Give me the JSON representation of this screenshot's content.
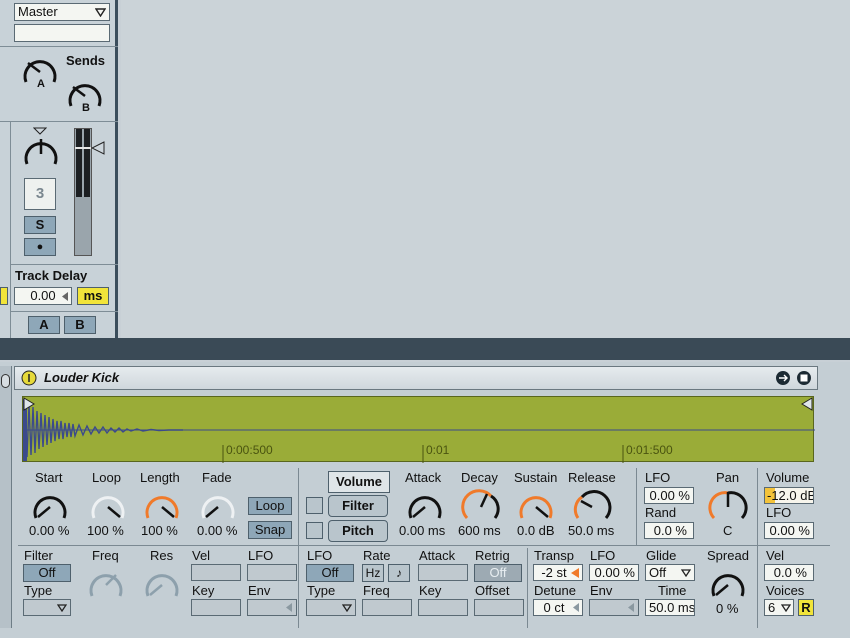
{
  "mixer": {
    "output_select": "Master",
    "sends_label": "Sends",
    "send_a": "A",
    "send_b": "B",
    "track_number": "3",
    "solo": "S",
    "arm": "●",
    "track_delay_label": "Track Delay",
    "track_delay_value": "0.00",
    "track_delay_unit": "ms",
    "crossfade_a": "A",
    "crossfade_b": "B"
  },
  "device": {
    "title": "Louder Kick",
    "waveform": {
      "time_markers": [
        "0:00:500",
        "0:01",
        "0:01:500"
      ]
    },
    "sample": {
      "start_label": "Start",
      "start_value": "0.00 %",
      "loop_label": "Loop",
      "loop_value": "100 %",
      "length_label": "Length",
      "length_value": "100 %",
      "fade_label": "Fade",
      "fade_value": "0.00 %",
      "loop_button": "Loop",
      "snap_button": "Snap"
    },
    "tabs": [
      "Volume",
      "Filter",
      "Pitch"
    ],
    "envelope": {
      "attack_label": "Attack",
      "attack_value": "0.00 ms",
      "decay_label": "Decay",
      "decay_value": "600 ms",
      "sustain_label": "Sustain",
      "sustain_value": "0.0 dB",
      "release_label": "Release",
      "release_value": "50.0 ms"
    },
    "lfo_pan": {
      "lfo_label": "LFO",
      "lfo_value": "0.00 %",
      "rand_label": "Rand",
      "rand_value": "0.0 %",
      "pan_label": "Pan",
      "pan_value": "C"
    },
    "volume": {
      "volume_label": "Volume",
      "volume_value": "-12.0 dB",
      "lfo_label": "LFO",
      "lfo_value": "0.00 %"
    },
    "filter": {
      "filter_label": "Filter",
      "filter_value": "Off",
      "type_label": "Type",
      "freq_label": "Freq",
      "res_label": "Res",
      "vel_label": "Vel",
      "key_label": "Key",
      "lfo_label": "LFO",
      "env_label": "Env"
    },
    "lfo": {
      "lfo_label": "LFO",
      "lfo_value": "Off",
      "rate_label": "Rate",
      "hz": "Hz",
      "note": "♪",
      "attack_label": "Attack",
      "retrig_label": "Retrig",
      "retrig_value": "Off",
      "type_label": "Type",
      "freq_label": "Freq",
      "key_label": "Key",
      "offset_label": "Offset"
    },
    "pitch": {
      "transp_label": "Transp",
      "transp_value": "-2 st",
      "lfo_label": "LFO",
      "lfo_value": "0.00 %",
      "detune_label": "Detune",
      "detune_value": "0 ct",
      "env_label": "Env"
    },
    "glide": {
      "glide_label": "Glide",
      "glide_value": "Off",
      "time_label": "Time",
      "time_value": "50.0 ms",
      "spread_label": "Spread",
      "spread_value": "0 %"
    },
    "voices": {
      "vel_label": "Vel",
      "vel_value": "0.0 %",
      "voices_label": "Voices",
      "voices_value": "6",
      "retrigger": "R"
    }
  }
}
